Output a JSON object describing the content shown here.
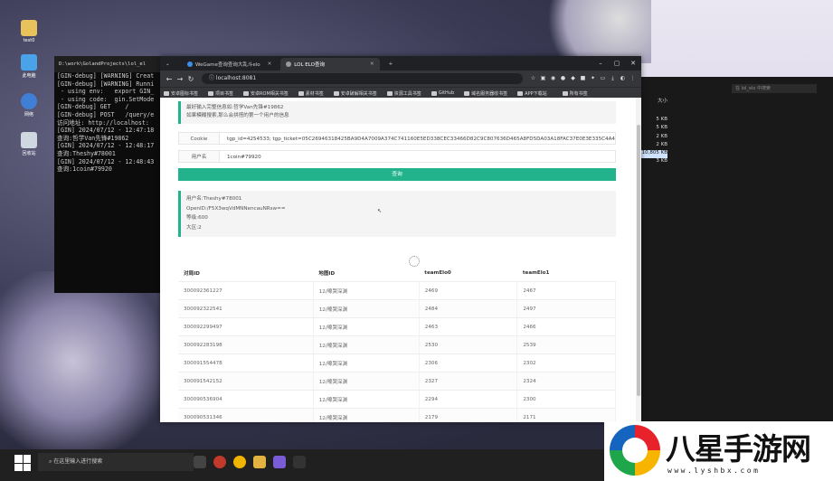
{
  "desktop": {
    "icons": [
      "test0",
      "此电脑",
      "网络",
      "回收站"
    ]
  },
  "terminal": {
    "title": "D:\\work\\GolandProjects\\lol_el",
    "lines": [
      "[GIN-debug] [WARNING] Creat",
      "",
      "[GIN-debug] [WARNING] Runni",
      " - using env:   export GIN_",
      " - using code:  gin.SetMode",
      "",
      "[GIN-debug] GET    /",
      "[GIN-debug] POST   /query/e",
      "访问地址: http://localhost:",
      "[GIN] 2024/07/12 - 12:47:18",
      "查询:哲学Van先锋#19862",
      "[GIN] 2024/07/12 - 12:48:17",
      "查询:Theshy#78001",
      "[GIN] 2024/07/12 - 12:48:43",
      "查询:1coin#79920"
    ]
  },
  "explorer": {
    "search_placeholder": "在 lol_elo 中搜索",
    "size_header": "大小",
    "sizes": [
      "5 KB",
      "5 KB",
      "2 KB",
      "2 KB",
      "10,805 KB",
      "3 KB"
    ]
  },
  "browser": {
    "tabs": [
      {
        "title": "WeGame查询查询大乱斗elo"
      },
      {
        "title": "LOL ELO查询"
      }
    ],
    "new_tab": "+",
    "url": "localhost:8081",
    "bookmarks": [
      "安卓图标书签",
      "项目书签",
      "安卓ROM相关书签",
      "素材书签",
      "安卓破解相关书签",
      "资源工具书签",
      "GitHub",
      "域名服务器收书签",
      "APP下载站"
    ],
    "all_bookmarks": "所有书签",
    "colors": {
      "accent": "#22b38c",
      "chrome_dark": "#202124"
    }
  },
  "page": {
    "tip_lines": [
      "最好输入完整信息如:哲学Van先锋#19862",
      "如果模糊搜索,那么会拼搭的第一个用户的信息"
    ],
    "cookie_label": "Cookie",
    "cookie_value": "tgp_id=4254533; tgp_ticket=05C26946318425BA9D4A7009A374C741160E5ED338CEC33466D82C9C807636D465A8FD5DA03A18FAC37E0E3E335C4A46F3A02D49",
    "username_label": "用户名",
    "username_value": "1coin#79920",
    "query_button": "查询",
    "result_lines": [
      "用户名:Theshy#78001",
      "OpenID:/F5X3wqVdMNNencauNRsw==",
      "等级:600",
      "大区:2"
    ],
    "table": {
      "headers": [
        "对局ID",
        "地图ID",
        "teamElo0",
        "teamElo1"
      ],
      "rows": [
        [
          "300092361227",
          "12/嚎哭深渊",
          "2469",
          "2467"
        ],
        [
          "300092322541",
          "12/嚎哭深渊",
          "2484",
          "2497"
        ],
        [
          "300092299497",
          "12/嚎哭深渊",
          "2463",
          "2466"
        ],
        [
          "300092283198",
          "12/嚎哭深渊",
          "2530",
          "2539"
        ],
        [
          "300091554478",
          "12/嚎哭深渊",
          "2306",
          "2302"
        ],
        [
          "300091542152",
          "12/嚎哭深渊",
          "2327",
          "2324"
        ],
        [
          "300090536904",
          "12/嚎哭深渊",
          "2294",
          "2300"
        ],
        [
          "300090531346",
          "12/嚎哭深渊",
          "2179",
          "2171"
        ]
      ]
    }
  },
  "taskbar": {
    "search_placeholder": "在这里输入进行搜索"
  },
  "watermark": {
    "text": "八星手游网",
    "url": "www.lyshbx.com"
  }
}
